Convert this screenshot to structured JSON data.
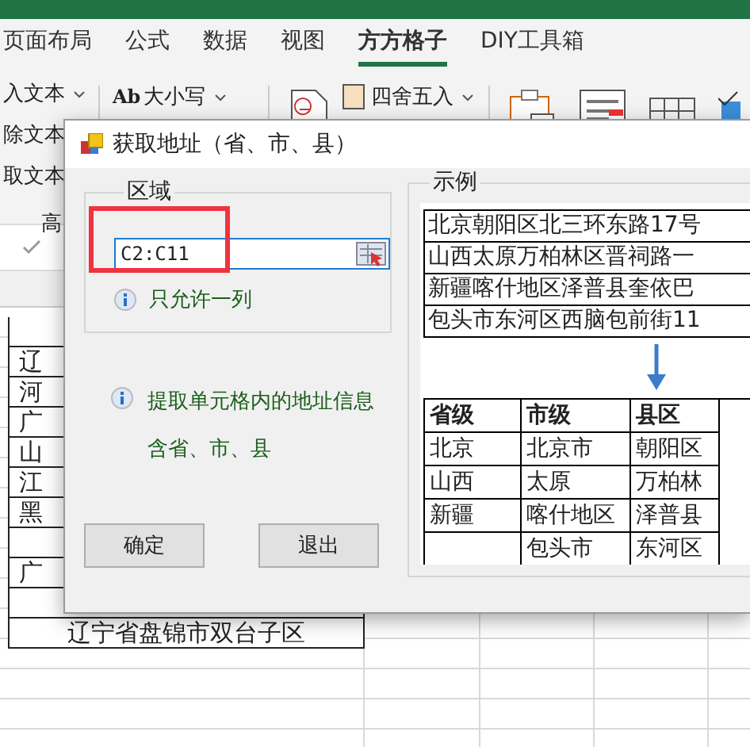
{
  "ribbon_tabs": [
    {
      "label": "页面布局",
      "selected": false
    },
    {
      "label": "公式",
      "selected": false
    },
    {
      "label": "数据",
      "selected": false
    },
    {
      "label": "视图",
      "selected": false
    },
    {
      "label": "方方格子",
      "selected": true
    },
    {
      "label": "DIY工具箱",
      "selected": false
    }
  ],
  "ribbon": {
    "text_items": [
      "入文本",
      "除文本",
      "取文本"
    ],
    "group_label": "高",
    "case_icon": "Ab",
    "case_label": "大小写",
    "round_label": "四舍五入"
  },
  "sheet_rows": [
    {},
    {
      "text": "辽"
    },
    {
      "text": "河"
    },
    {
      "text": "广"
    },
    {
      "text": "山"
    },
    {
      "text": "江"
    },
    {
      "text": "黑"
    },
    {},
    {
      "text": "广"
    },
    {},
    {
      "text": "辽宁省盘锦市双台子区"
    }
  ],
  "dialog": {
    "title": "获取地址（省、市、县）",
    "region": {
      "legend": "区域",
      "value": "C2:C11",
      "note": "只允许一列"
    },
    "info_lines": [
      "提取单元格内的地址信息",
      "含省、市、县"
    ],
    "buttons": [
      "确定",
      "退出"
    ],
    "example": {
      "legend": "示例",
      "addresses": [
        "北京朝阳区北三环东路17号",
        "山西太原万柏林区晋祠路一",
        "新疆喀什地区泽普县奎依巴",
        "包头市东河区西脑包前街11"
      ],
      "columns": [
        "省级",
        "市级",
        "县区"
      ],
      "rows": [
        [
          "北京",
          "北京市",
          "朝阳区"
        ],
        [
          "山西",
          "太原",
          "万柏林"
        ],
        [
          "新疆",
          "喀什地区",
          "泽普县"
        ],
        [
          null,
          "包头市",
          "东河区"
        ]
      ]
    }
  }
}
